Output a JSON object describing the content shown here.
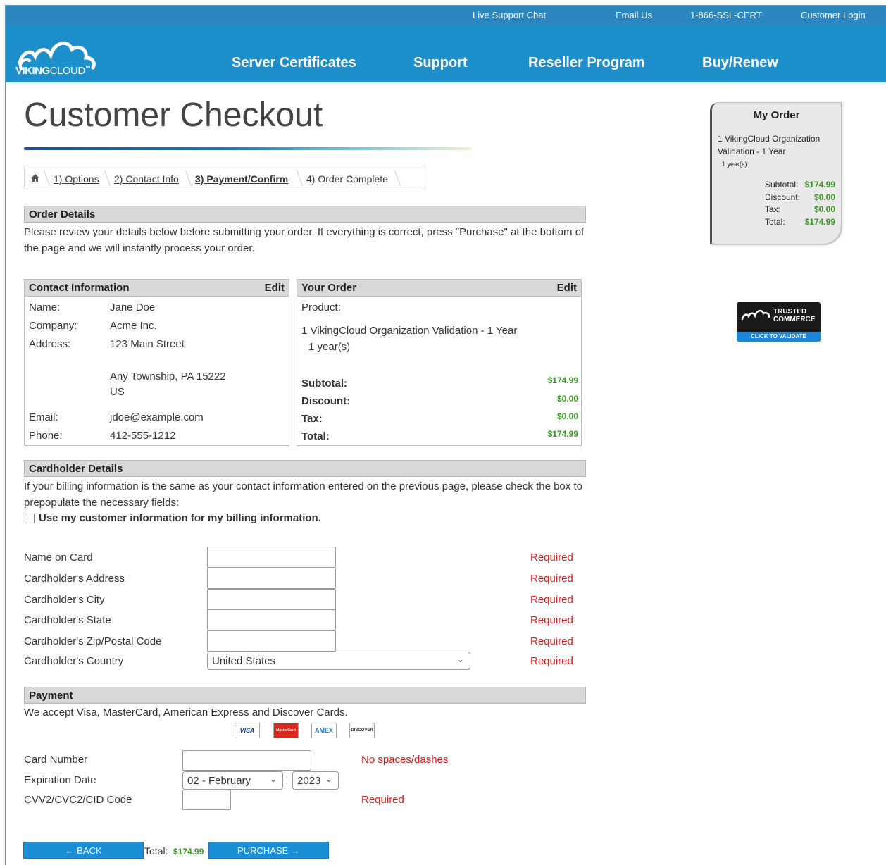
{
  "topbar": {
    "live_chat": "Live Support Chat",
    "email": "Email Us",
    "phone": "1-866-SSL-CERT",
    "login": "Customer Login"
  },
  "brand": {
    "logo_main": "VIKING",
    "logo_sub": "CLOUD",
    "logo_mark": "™"
  },
  "nav": {
    "server_certs": "Server Certificates",
    "support": "Support",
    "reseller": "Reseller Program",
    "buy": "Buy/Renew"
  },
  "page_title": "Customer Checkout",
  "breadcrumb": {
    "home_icon": "home-icon",
    "steps": [
      "1) Options",
      "2) Contact Info",
      "3) Payment/Confirm",
      "4) Order Complete"
    ]
  },
  "order_details": {
    "heading": "Order Details",
    "text": "Please review your details below before submitting your order. If everything is correct, press \"Purchase\" at the bottom of the page and we will instantly process your order."
  },
  "contact": {
    "heading": "Contact Information",
    "edit": "Edit",
    "name_label": "Name:",
    "name": "Jane Doe",
    "company_label": "Company:",
    "company": "Acme Inc.",
    "address_label": "Address:",
    "address1": "123 Main Street",
    "address2": "Any Township, PA 15222",
    "country": "US",
    "email_label": "Email:",
    "email": "jdoe@example.com",
    "phone_label": "Phone:",
    "phone": "412-555-1212"
  },
  "your_order": {
    "heading": "Your Order",
    "edit": "Edit",
    "product_label": "Product:",
    "product": "1 VikingCloud Organization Validation - 1 Year",
    "term": "1 year(s)",
    "subtotal_label": "Subtotal:",
    "subtotal": "$174.99",
    "discount_label": "Discount:",
    "discount": "$0.00",
    "tax_label": "Tax:",
    "tax": "$0.00",
    "total_label": "Total:",
    "total": "$174.99"
  },
  "cardholder": {
    "heading": "Cardholder Details",
    "text": "If your billing information is the same as your contact information entered on the previous page, please check the box to prepopulate the necessary fields:",
    "checkbox_label": "Use my customer information for my billing information.",
    "fields": [
      {
        "label": "Name on Card",
        "status": "Required"
      },
      {
        "label": "Cardholder's Address",
        "status": "Required"
      },
      {
        "label": "Cardholder's City",
        "status": "Required"
      },
      {
        "label": "Cardholder's State",
        "status": "Required"
      },
      {
        "label": "Cardholder's Zip/Postal Code",
        "status": "Required"
      },
      {
        "label": "Cardholder's Country",
        "status": "Required"
      }
    ],
    "country_value": "United States"
  },
  "payment": {
    "heading": "Payment",
    "text": "We accept Visa, MasterCard, American Express and Discover Cards.",
    "cards": [
      "VISA",
      "MasterCard",
      "AMEX",
      "DISCOVER"
    ],
    "card_number_label": "Card Number",
    "card_number_note": "No spaces/dashes",
    "expiration_label": "Expiration Date",
    "exp_month": "02 - February",
    "exp_year": "2023",
    "cvv_label": "CVV2/CVC2/CID Code",
    "cvv_note": "Required"
  },
  "footer": {
    "back": "← BACK",
    "total_label": "Total:",
    "total": "$174.99",
    "purchase": "PURCHASE →"
  },
  "sidebar": {
    "title": "My Order",
    "line1": "1 VikingCloud Organization",
    "line2": "Validation - 1 Year",
    "term": "1 year(s)",
    "subtotal_label": "Subtotal:",
    "subtotal": "$174.99",
    "discount_label": "Discount:",
    "discount": "$0.00",
    "tax_label": "Tax:",
    "tax": "$0.00",
    "total_label": "Total:",
    "total": "$174.99"
  },
  "badge": {
    "line1": "TRUSTED",
    "line2": "COMMERCE",
    "cta": "CLICK TO VALIDATE"
  },
  "colors": {
    "nav_blue": "#1d8fca",
    "price_green": "#3a9a28",
    "required_red": "#d91a1a",
    "button_blue": "#1b8fd6"
  }
}
